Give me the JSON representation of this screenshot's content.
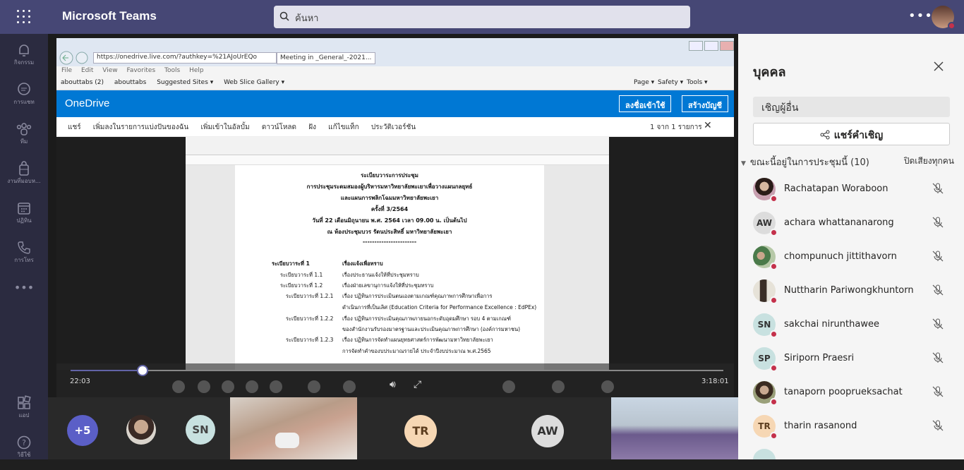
{
  "app": {
    "title": "Microsoft Teams",
    "search_placeholder": "ค้นหา"
  },
  "rail": [
    {
      "label": "กิจกรรม",
      "icon": "bell-icon"
    },
    {
      "label": "การแชท",
      "icon": "chat-icon"
    },
    {
      "label": "ทีม",
      "icon": "teams-icon"
    },
    {
      "label": "งานที่มอบห...",
      "icon": "assignments-icon"
    },
    {
      "label": "ปฏิทิน",
      "icon": "calendar-icon"
    },
    {
      "label": "การโทร",
      "icon": "phone-icon"
    },
    {
      "label": "แอป",
      "icon": "apps-icon"
    },
    {
      "label": "วิธีใช้",
      "icon": "help-icon"
    }
  ],
  "browser": {
    "url": "https://onedrive.live.com/?authkey=%21AJoUrEQo",
    "tab": "Meeting in _General_-2021...",
    "menu": [
      "File",
      "Edit",
      "View",
      "Favorites",
      "Tools",
      "Help"
    ],
    "favorites": [
      "abouttabs (2)",
      "abouttabs",
      "Suggested Sites ▾",
      "Web Slice Gallery ▾"
    ],
    "commands": [
      "Page ▾",
      "Safety ▾",
      "Tools ▾"
    ]
  },
  "onedrive": {
    "title": "OneDrive",
    "signin": "ลงชื่อเข้าใช้",
    "create": "สร้างบัญชี",
    "tools": [
      "แชร์",
      "เพิ่มลงในรายการแบ่งปันของฉัน",
      "เพิ่มเข้าในอัลบั้ม",
      "ดาวน์โหลด",
      "ฝัง",
      "แก้ไขแท็ก",
      "ประวัติเวอร์ชัน"
    ],
    "count": "1 จาก 1 รายการ"
  },
  "doc": {
    "lines": [
      "ระเบียบวาระการประชุม",
      "การประชุมระดมสมองผู้บริหารมหาวิทยาลัยพะเยาเพื่อวางแผนกลยุทธ์",
      "และแผนการพลิกโฉมมหาวิทยาลัยพะเยา",
      "ครั้งที่ 3/2564",
      "วันที่ 22 เดือนมิถุนายน พ.ศ. 2564 เวลา 09.00 น. เป็นต้นไป",
      "ณ ห้องประชุมบวร รัตนประสิทธิ์ มหาวิทยาลัยพะเยา",
      "-----------------------"
    ],
    "agenda": [
      {
        "no": "ระเบียบวาระที่ 1",
        "text": "เรื่องแจ้งเพื่อทราบ"
      },
      {
        "no": "ระเบียบวาระที่ 1.1",
        "text": "เรื่องประธานแจ้งให้ที่ประชุมทราบ"
      },
      {
        "no": "ระเบียบวาระที่ 1.2",
        "text": "เรื่องฝ่ายเลขานุการแจ้งให้ที่ประชุมทราบ"
      },
      {
        "no": "ระเบียบวาระที่ 1.2.1",
        "text": "เรื่อง ปฏิทินการประเมินตนเองตามเกณฑ์คุณภาพการศึกษาเพื่อการ"
      },
      {
        "no": "",
        "text": "ดำเนินการที่เป็นเลิศ (Education Criteria for Performance Excellence : EdPEx)"
      },
      {
        "no": "ระเบียบวาระที่ 1.2.2",
        "text": "เรื่อง ปฏิทินการประเมินคุณภาพภายนอกระดับอุดมศึกษา รอบ 4 ตามเกณฑ์"
      },
      {
        "no": "",
        "text": "ของสำนักงานรับรองมาตรฐานและประเมินคุณภาพการศึกษา (องค์การมหาชน)"
      },
      {
        "no": "ระเบียบวาระที่ 1.2.3",
        "text": "เรื่อง ปฏิทินการจัดทำแผนยุทธศาสตร์การพัฒนามหาวิทยาลัยพะเยา"
      },
      {
        "no": "",
        "text": "การจัดทำคำของบประมาณรายได้ ประจำปีงบประมาณ พ.ศ.2565"
      }
    ]
  },
  "player": {
    "current": "22:03",
    "total": "3:18:01",
    "progress": 0.11
  },
  "gallery": {
    "more": "+5",
    "tiles": [
      "SN",
      "TR",
      "AW"
    ]
  },
  "panel": {
    "title": "บุคคล",
    "invite_placeholder": "เชิญผู้อื่น",
    "share_invite": "แชร์คำเชิญ",
    "section": "ขณะนี้อยู่ในการประชุมนี้ (10)",
    "mute_all": "ปิดเสียงทุกคน",
    "people": [
      {
        "name": "Rachatapan Woraboon",
        "initials": "",
        "photo": true
      },
      {
        "name": "achara whattananarong",
        "initials": "AW",
        "photo": false
      },
      {
        "name": "chompunuch jittithavorn",
        "initials": "",
        "photo": true
      },
      {
        "name": "Nuttharin Pariwongkhuntorn",
        "initials": "",
        "photo": true
      },
      {
        "name": "sakchai nirunthawee",
        "initials": "SN",
        "photo": false
      },
      {
        "name": "Siriporn Praesri",
        "initials": "SP",
        "photo": false
      },
      {
        "name": "tanaporn pooprueksachat",
        "initials": "",
        "photo": true
      },
      {
        "name": "tharin rasanond",
        "initials": "TR",
        "photo": false
      }
    ]
  }
}
